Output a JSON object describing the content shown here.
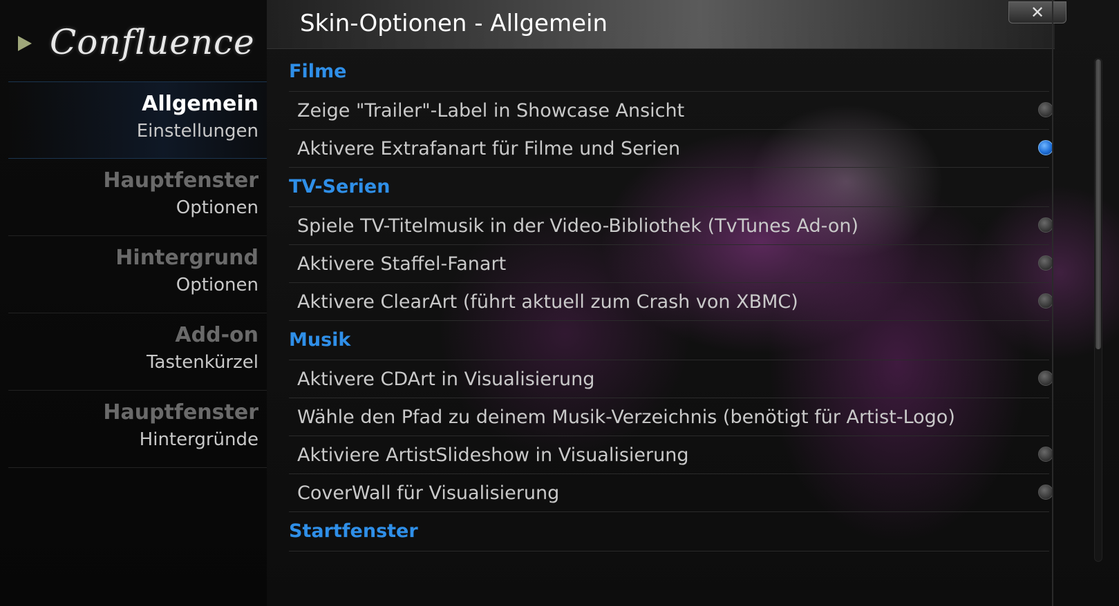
{
  "sidebar": {
    "logo_text": "Confluence",
    "items": [
      {
        "title": "Allgemein",
        "subtitle": "Einstellungen"
      },
      {
        "title": "Hauptfenster",
        "subtitle": "Optionen"
      },
      {
        "title": "Hintergrund",
        "subtitle": "Optionen"
      },
      {
        "title": "Add-on",
        "subtitle": "Tastenkürzel"
      },
      {
        "title": "Hauptfenster",
        "subtitle": "Hintergründe"
      }
    ]
  },
  "dialog": {
    "title": "Skin-Optionen - Allgemein",
    "close_label": "✕"
  },
  "sections": {
    "filme": {
      "label": "Filme",
      "rows": [
        {
          "label": "Zeige \"Trailer\"-Label in Showcase Ansicht",
          "enabled": false
        },
        {
          "label": "Aktivere Extrafanart für Filme und Serien",
          "enabled": true
        }
      ]
    },
    "tvserien": {
      "label": "TV-Serien",
      "rows": [
        {
          "label": "Spiele TV-Titelmusik in der Video-Bibliothek (TvTunes Ad-on)",
          "enabled": false
        },
        {
          "label": "Aktivere Staffel-Fanart",
          "enabled": false
        },
        {
          "label": "Aktivere ClearArt (führt aktuell zum Crash von XBMC)",
          "enabled": false
        }
      ]
    },
    "musik": {
      "label": "Musik",
      "rows": [
        {
          "label": "Aktivere CDArt in Visualisierung",
          "enabled": false
        },
        {
          "label": "Wähle den Pfad zu deinem Musik-Verzeichnis (benötigt für Artist-Logo)"
        },
        {
          "label": "Aktiviere ArtistSlideshow in Visualisierung",
          "enabled": false
        },
        {
          "label": "CoverWall für Visualisierung",
          "enabled": false
        }
      ]
    },
    "startfenster": {
      "label": "Startfenster"
    }
  },
  "colors": {
    "section_heading": "#2f8fe8",
    "radio_on": "#1e6fd8",
    "radio_off": "#3a3a3a"
  },
  "icons": {
    "logo_arrow": "play-triangle-icon",
    "close": "close-icon",
    "toggle_on": "radio-on-icon",
    "toggle_off": "radio-off-icon"
  }
}
